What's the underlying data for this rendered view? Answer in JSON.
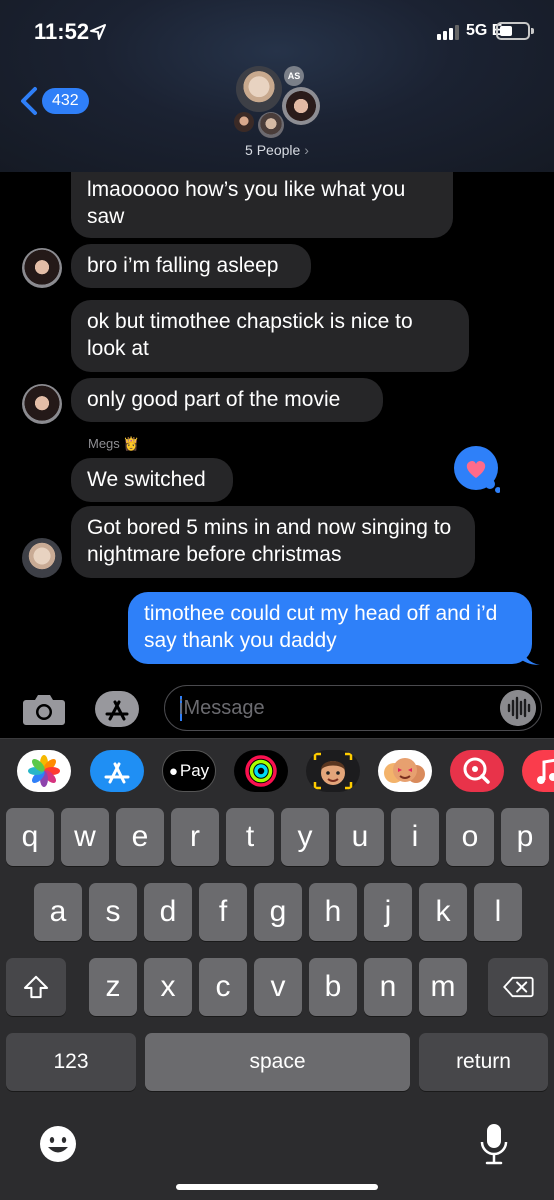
{
  "status_bar": {
    "time": "11:52",
    "network": "5G E"
  },
  "header": {
    "back_count": "432",
    "group_name": "5 People",
    "initials_avatar": "AS"
  },
  "messages": [
    {
      "text": "lmaooooo how’s you like what you saw",
      "direction": "incoming"
    },
    {
      "text": "bro i’m falling asleep",
      "direction": "incoming"
    },
    {
      "text": "ok but timothee chapstick is nice to look at",
      "direction": "incoming",
      "tapback": "heart-icon"
    },
    {
      "text": "only good part of the movie",
      "direction": "incoming"
    },
    {
      "sender": "Megs 👸",
      "text": "We switched",
      "direction": "incoming"
    },
    {
      "text": "Got bored 5 mins in and now singing to nightmare before christmas",
      "direction": "incoming"
    },
    {
      "text": "timothee could cut my head off and i’d say thank you daddy",
      "direction": "outgoing"
    }
  ],
  "compose": {
    "placeholder": "iMessage"
  },
  "app_drawer": {
    "apple_pay_label": "Pay"
  },
  "keyboard": {
    "row1": [
      "q",
      "w",
      "e",
      "r",
      "t",
      "y",
      "u",
      "i",
      "o",
      "p"
    ],
    "row2": [
      "a",
      "s",
      "d",
      "f",
      "g",
      "h",
      "j",
      "k",
      "l"
    ],
    "row3": [
      "z",
      "x",
      "c",
      "v",
      "b",
      "n",
      "m"
    ],
    "numbers_key": "123",
    "space_key": "space",
    "return_key": "return"
  },
  "colors": {
    "accent": "#2e80f9",
    "incoming_bubble": "#262628",
    "keyboard_bg": "#2c2c2e",
    "key": "#6b6b6e"
  }
}
